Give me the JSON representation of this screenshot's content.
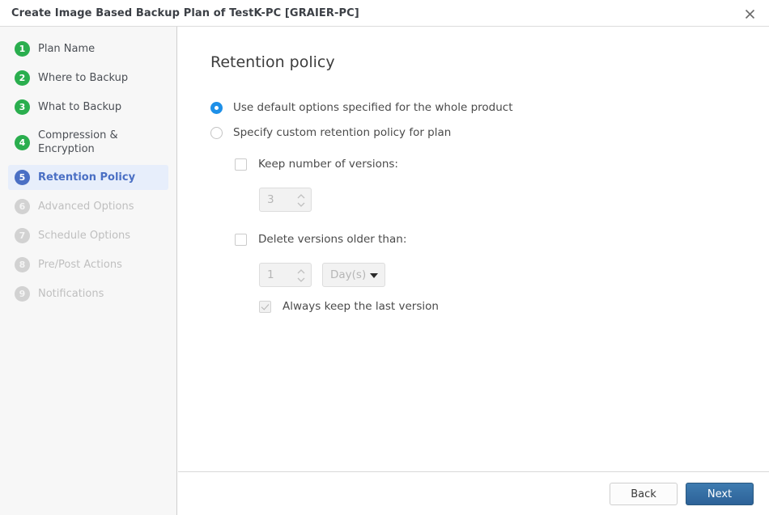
{
  "window": {
    "title": "Create Image Based Backup Plan of TestK-PC [GRAIER-PC]",
    "close_icon": "close-icon"
  },
  "sidebar": {
    "steps": [
      {
        "number": "1",
        "label": "Plan Name",
        "state": "done"
      },
      {
        "number": "2",
        "label": "Where to Backup",
        "state": "done"
      },
      {
        "number": "3",
        "label": "What to Backup",
        "state": "done"
      },
      {
        "number": "4",
        "label": "Compression & Encryption",
        "state": "done"
      },
      {
        "number": "5",
        "label": "Retention Policy",
        "state": "active"
      },
      {
        "number": "6",
        "label": "Advanced Options",
        "state": "todo"
      },
      {
        "number": "7",
        "label": "Schedule Options",
        "state": "todo"
      },
      {
        "number": "8",
        "label": "Pre/Post Actions",
        "state": "todo"
      },
      {
        "number": "9",
        "label": "Notifications",
        "state": "todo"
      }
    ]
  },
  "main": {
    "title": "Retention policy",
    "radio_default_label": "Use default options specified for the whole product",
    "radio_custom_label": "Specify custom retention policy for plan",
    "keep_versions_label": "Keep number of versions:",
    "keep_versions_value": "3",
    "delete_older_label": "Delete versions older than:",
    "delete_older_value": "1",
    "period_unit_value": "Day(s)",
    "always_keep_label": "Always keep the last version"
  },
  "footer": {
    "back_label": "Back",
    "next_label": "Next"
  },
  "colors": {
    "accent_blue": "#1e90e8",
    "step_done_green": "#2aae4e",
    "step_active_blue": "#4a6fc4",
    "primary_button_blue": "#2d6298",
    "sidebar_bg": "#f7f7f7"
  }
}
